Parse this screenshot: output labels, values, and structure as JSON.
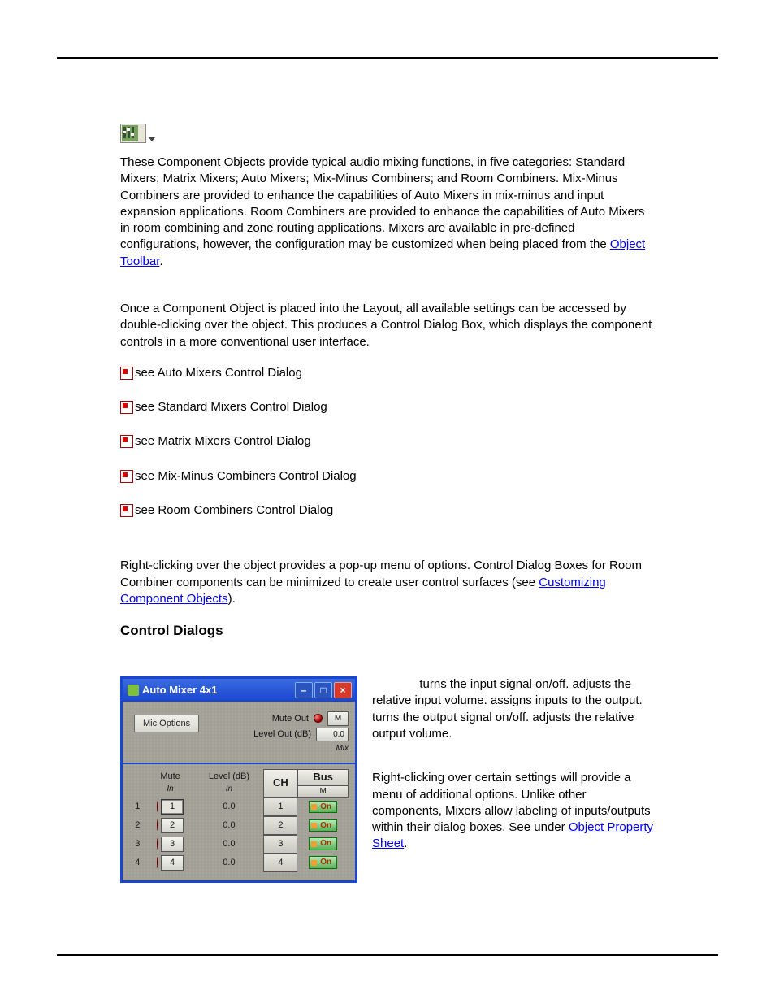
{
  "intro": {
    "p1a": "These Component Objects provide typical audio mixing functions, in five categories: Standard Mixers; Matrix Mixers; Auto Mixers; Mix-Minus Combiners; and Room Combiners. Mix-Minus Combiners are provided to enhance the capabilities of Auto Mixers in mix-minus and input expansion applications. Room Combiners are provided to enhance the capabilities of Auto Mixers in room combining and zone routing applications. Mixers are available in pre-defined configurations, however, the configuration may be customized when being placed from the ",
    "link1": "Object Toolbar",
    "p1b": ".",
    "p2": "Once a Component Object is placed into the Layout, all available settings can be accessed by double-clicking over the object. This produces a Control Dialog Box, which displays the component controls in a more conventional user interface."
  },
  "see_list": [
    "see Auto Mixers Control Dialog",
    "see Standard Mixers Control Dialog",
    "see Matrix Mixers Control Dialog",
    "see Mix-Minus Combiners Control Dialog",
    "see Room Combiners Control Dialog"
  ],
  "post_list": {
    "a": "Right-clicking over the object provides a pop-up menu of options. Control Dialog Boxes for Room Combiner components can be minimized to create user control surfaces (see ",
    "link": "Customizing Component Objects",
    "b": ")."
  },
  "section_heading": "Control Dialogs",
  "dialog": {
    "title": "Auto Mixer 4x1",
    "mic_options": "Mic Options",
    "mute_out": "Mute Out",
    "level_out": "Level Out (dB)",
    "level_out_val": "0.0",
    "m_btn": "M",
    "mix_label": "Mix",
    "headers": {
      "mute": "Mute",
      "in1": "In",
      "level": "Level (dB)",
      "in2": "In",
      "ch": "CH",
      "bus": "Bus",
      "bus_m": "M"
    },
    "rows": [
      {
        "n": "1",
        "num": "1",
        "lvl": "0.0",
        "ch": "1",
        "on": "On"
      },
      {
        "n": "2",
        "num": "2",
        "lvl": "0.0",
        "ch": "2",
        "on": "On"
      },
      {
        "n": "3",
        "num": "3",
        "lvl": "0.0",
        "ch": "3",
        "on": "On"
      },
      {
        "n": "4",
        "num": "4",
        "lvl": "0.0",
        "ch": "4",
        "on": "On"
      }
    ]
  },
  "explain": {
    "p1": " turns the input signal on/off. adjusts the relative input volume.               assigns inputs to the output.                  turns the output signal on/off.                 adjusts the relative output volume.",
    "p2a": "Right-clicking over certain settings will provide a menu of additional options. Unlike other components, Mixers allow labeling of inputs/outputs within their dialog boxes. See                                under ",
    "link": "Object Property Sheet",
    "p2b": "."
  }
}
